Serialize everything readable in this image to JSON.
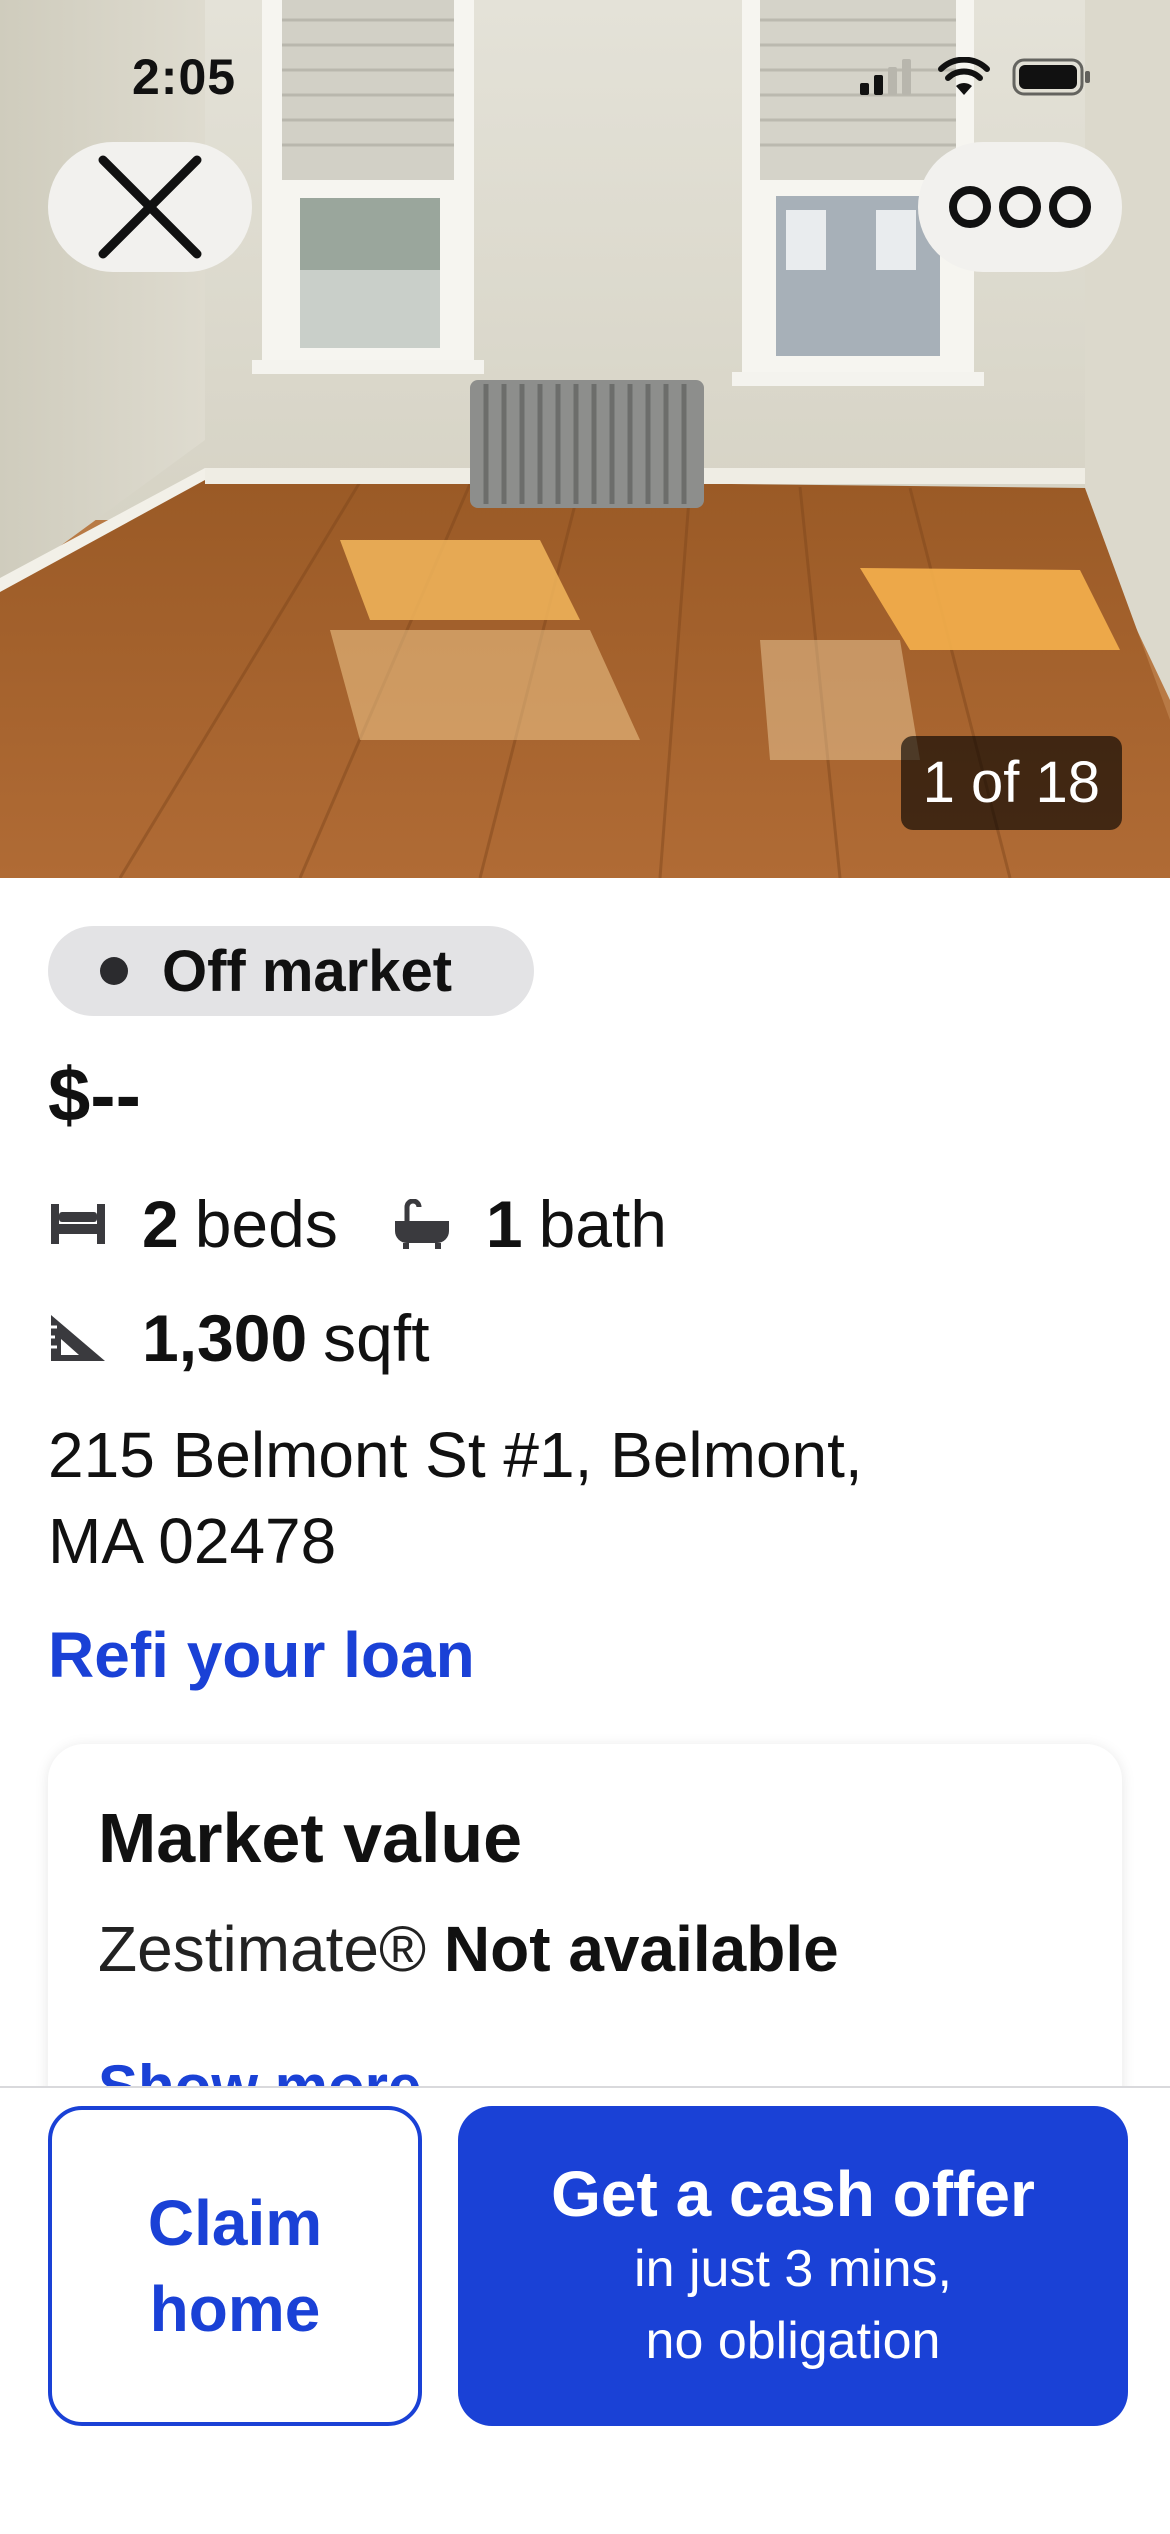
{
  "status_bar": {
    "time": "2:05"
  },
  "colors": {
    "accent": "#1a41d6",
    "badge_bg": "#e3e3e5",
    "text": "#16171a"
  },
  "photo": {
    "counter": "1 of 18"
  },
  "listing": {
    "status": "Off market",
    "price": "$--",
    "beds_value": "2",
    "beds_unit": "beds",
    "baths_value": "1",
    "baths_unit": "bath",
    "sqft_value": "1,300",
    "sqft_unit": "sqft",
    "address_line1": "215 Belmont St #1, Belmont,",
    "address_line2": "MA 02478",
    "refi_link": "Refi your loan"
  },
  "market_value": {
    "title": "Market value",
    "label": "Zestimate®",
    "value": "Not available",
    "show_more": "Show more"
  },
  "actions": {
    "claim_line1": "Claim",
    "claim_line2": "home",
    "cash_title": "Get a cash offer",
    "cash_sub1": "in just 3 mins,",
    "cash_sub2": "no obligation"
  }
}
